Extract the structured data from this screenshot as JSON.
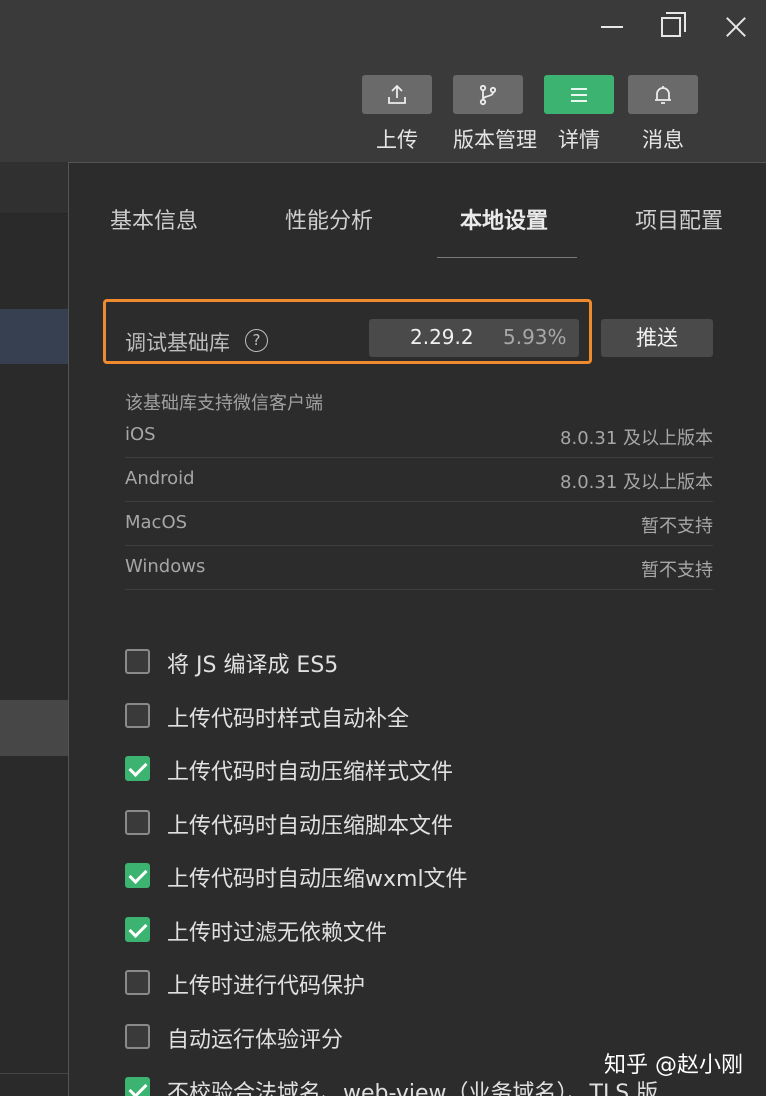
{
  "toolbar": {
    "items": [
      {
        "label": "上传",
        "icon": "upload-icon"
      },
      {
        "label": "版本管理",
        "icon": "branch-icon"
      },
      {
        "label": "详情",
        "icon": "menu-icon",
        "active": true
      },
      {
        "label": "消息",
        "icon": "bell-icon"
      }
    ]
  },
  "tabs": [
    {
      "label": "基本信息"
    },
    {
      "label": "性能分析"
    },
    {
      "label": "本地设置",
      "active": true
    },
    {
      "label": "项目配置"
    }
  ],
  "debug_lib": {
    "label": "调试基础库",
    "version": "2.29.2",
    "percent": "5.93%",
    "push_label": "推送"
  },
  "support": {
    "title": "该基础库支持微信客户端",
    "rows": [
      {
        "platform": "iOS",
        "value": "8.0.31 及以上版本"
      },
      {
        "platform": "Android",
        "value": "8.0.31 及以上版本"
      },
      {
        "platform": "MacOS",
        "value": "暂不支持"
      },
      {
        "platform": "Windows",
        "value": "暂不支持"
      }
    ]
  },
  "options": [
    {
      "label": "将 JS 编译成 ES5",
      "checked": false
    },
    {
      "label": "上传代码时样式自动补全",
      "checked": false
    },
    {
      "label": "上传代码时自动压缩样式文件",
      "checked": true
    },
    {
      "label": "上传代码时自动压缩脚本文件",
      "checked": false
    },
    {
      "label": "上传代码时自动压缩wxml文件",
      "checked": true
    },
    {
      "label": "上传时过滤无依赖文件",
      "checked": true
    },
    {
      "label": "上传时进行代码保护",
      "checked": false
    },
    {
      "label": "自动运行体验评分",
      "checked": false
    },
    {
      "label": "不校验合法域名、web-view（业务域名）、TLS 版",
      "checked": true
    }
  ],
  "watermark": "知乎 @赵小刚",
  "colors": {
    "accent_green": "#3cb371",
    "highlight_orange": "#f08a2e"
  }
}
